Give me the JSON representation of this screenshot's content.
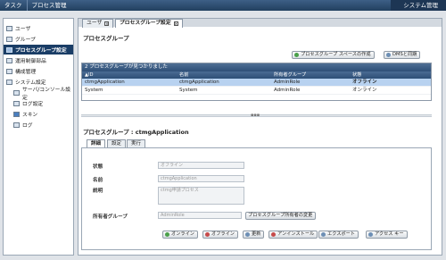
{
  "topbar": {
    "menu": [
      "タスク",
      "プロセス管理"
    ],
    "right_label": "システム管理"
  },
  "sidebar": {
    "items": [
      {
        "label": "ユーザ"
      },
      {
        "label": "グループ"
      },
      {
        "label": "プロセスグループ設定"
      },
      {
        "label": "運用制御部品"
      },
      {
        "label": "構成管理"
      },
      {
        "label": "システム設定"
      },
      {
        "label": "サーバ/コンソール設定"
      },
      {
        "label": "ログ設定"
      },
      {
        "label": "スキン"
      },
      {
        "label": "ログ"
      }
    ]
  },
  "tabs": [
    {
      "label": "ユーザ"
    },
    {
      "label": "プロセスグループ設定"
    }
  ],
  "main": {
    "title": "プロセスグループ",
    "create_space_btn": "プロセスグループ スペースの作成",
    "dms_sync_btn": "DMSと同期",
    "found_text": "2 プロセスグループが見つかりました",
    "columns": [
      "ID",
      "名前",
      "所有者グループ",
      "状態"
    ],
    "rows": [
      {
        "id": "ctmgApplication",
        "name": "ctmgApplication",
        "owner": "AdminRole",
        "status": "オフライン"
      },
      {
        "id": "System",
        "name": "System",
        "owner": "AdminRole",
        "status": "オンライン"
      }
    ]
  },
  "detail": {
    "title": "プロセスグループ : ctmgApplication",
    "tabs": [
      "詳細",
      "設定",
      "実行"
    ],
    "fields": {
      "status_label": "状態",
      "status_value": "オフライン",
      "name_label": "名前",
      "name_value": "ctmgApplication",
      "desc_label": "説明",
      "desc_value": "ctmg申請プロセス",
      "owner_label": "所有者グループ",
      "owner_value": "AdminRole"
    },
    "change_owner_btn": "プロセスグループ所有者の変更",
    "actions": [
      "オンライン",
      "オフライン",
      "更新",
      "アンインストール",
      "エクスポート",
      "アクセス キー"
    ]
  }
}
